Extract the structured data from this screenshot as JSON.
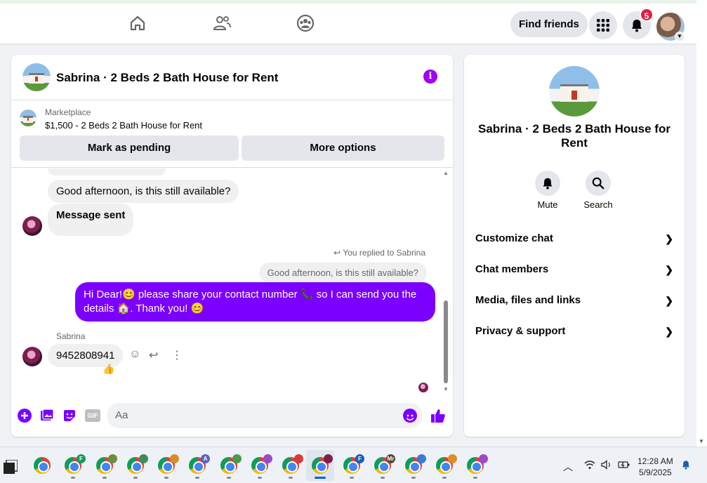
{
  "topbar": {
    "find_friends_label": "Find friends",
    "notification_count": "5"
  },
  "chat": {
    "title": "Sabrina · 2 Beds 2 Bath House for Rent",
    "info_icon_label": "i",
    "marketplace_label": "Marketplace",
    "listing": "$1,500 - 2 Beds 2 Bath House for Rent",
    "mark_pending_label": "Mark as pending",
    "more_options_label": "More options",
    "messages": {
      "incoming_1": "Good afternoon, is this still available?",
      "incoming_2": "Message sent",
      "replied_label": "You replied to Sabrina",
      "replied_quote": "Good afternoon, is this still available?",
      "outgoing": "Hi Dear!😊 please share your contact number 📞 so I can send you the details 🏠. Thank you! 😊",
      "sender_name": "Sabrina",
      "incoming_3": "9452808941",
      "reaction": "👍"
    },
    "composer": {
      "placeholder": "Aa",
      "gif_label": "GIF"
    }
  },
  "info_panel": {
    "title": "Sabrina · 2 Beds 2 Bath House for Rent",
    "actions": [
      {
        "label": "Mute",
        "icon": "bell-icon"
      },
      {
        "label": "Search",
        "icon": "search-icon"
      }
    ],
    "sections": [
      {
        "label": "Customize chat"
      },
      {
        "label": "Chat members"
      },
      {
        "label": "Media, files and links"
      },
      {
        "label": "Privacy & support"
      }
    ]
  },
  "taskbar": {
    "time": "12:28 AM",
    "date": "5/9/2025",
    "badges": [
      "F",
      "A",
      "F",
      "Mr"
    ]
  },
  "colors": {
    "accent": "#7b00ff",
    "info": "#a100f2",
    "notification": "#e41e3f"
  }
}
